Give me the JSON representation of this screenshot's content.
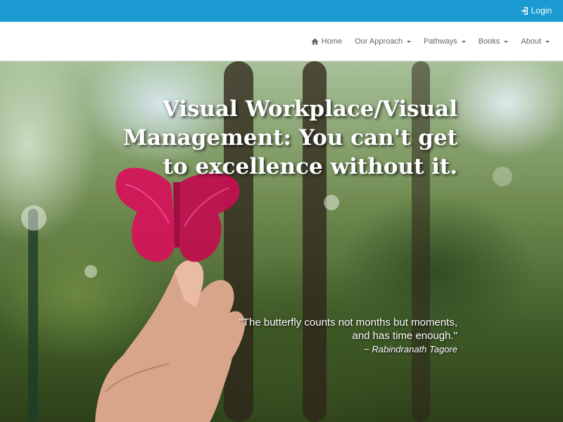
{
  "topbar": {
    "login_label": "Login"
  },
  "nav": {
    "items": [
      {
        "label": "Home",
        "icon": "home-icon"
      },
      {
        "label": "Our Approach",
        "dropdown": true
      },
      {
        "label": "Pathways",
        "dropdown": true
      },
      {
        "label": "Books",
        "dropdown": true
      },
      {
        "label": "About",
        "dropdown": true
      }
    ]
  },
  "hero": {
    "title": "Visual Workplace/Visual Management: You can't get to excellence without it.",
    "quote_line1": "\"The butterfly counts not months but moments,",
    "quote_line2": "and has time enough.\"",
    "quote_author": "~ Rabindranath Tagore",
    "image_description": "hand holding a pink butterfly cutout in a forest"
  },
  "colors": {
    "topbar": "#1b9bd1",
    "nav_text": "#666666",
    "butterfly": "#d4145a"
  }
}
